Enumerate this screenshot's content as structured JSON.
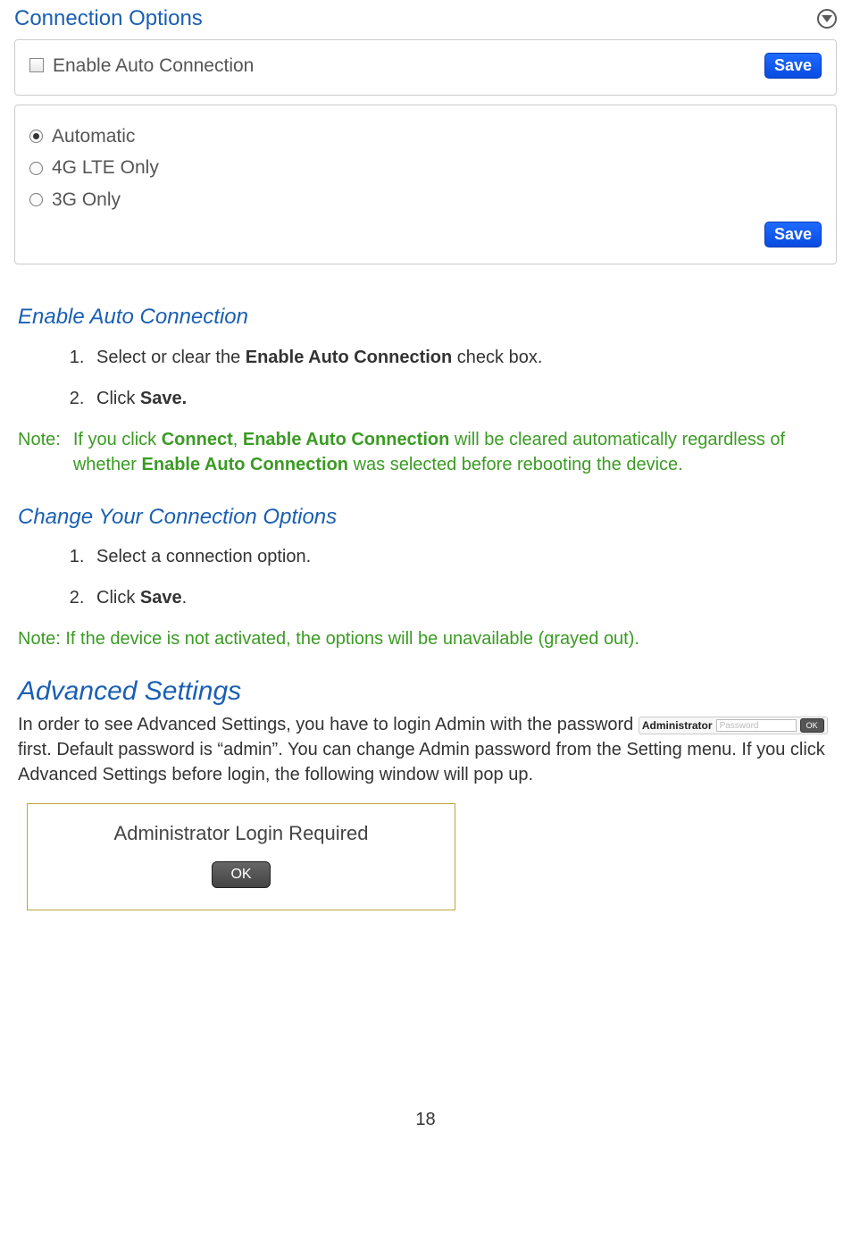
{
  "panel": {
    "title": "Connection Options",
    "auto_label": "Enable Auto Connection",
    "save_label": "Save",
    "options": {
      "automatic": "Automatic",
      "lte": "4G LTE Only",
      "g3": "3G Only"
    }
  },
  "section1": {
    "heading": "Enable Auto Connection",
    "step1_pre": "Select or clear the ",
    "step1_bold": "Enable Auto Connection",
    "step1_post": " check box.",
    "step2_pre": "Click ",
    "step2_bold": "Save."
  },
  "note1": {
    "prefix": "Note:",
    "t1": "If you click ",
    "b1": "Connect",
    "t2": ", ",
    "b2": "Enable Auto Connection",
    "t3": " will be cleared automatically regardless of whether ",
    "b3": "Enable Auto Connection",
    "t4": " was selected before rebooting the device."
  },
  "section2": {
    "heading": "Change Your Connection Options",
    "step1": "Select a connection option.",
    "step2_pre": "Click ",
    "step2_bold": "Save",
    "step2_post": "."
  },
  "note2": "Note: If the device is not activated, the options will be unavailable (grayed out).",
  "adv": {
    "heading": "Advanced Settings",
    "p_pre": "In order to see Advanced Settings, you have to login Admin with the password ",
    "login_label": "Administrator",
    "login_placeholder": "Password",
    "login_ok": "OK",
    "p_post": "first.  Default password is “admin”.  You can change Admin password from the Setting menu.  If you click Advanced Settings before login, the following window will pop up."
  },
  "popup": {
    "title": "Administrator Login Required",
    "ok": "OK"
  },
  "page_number": "18"
}
